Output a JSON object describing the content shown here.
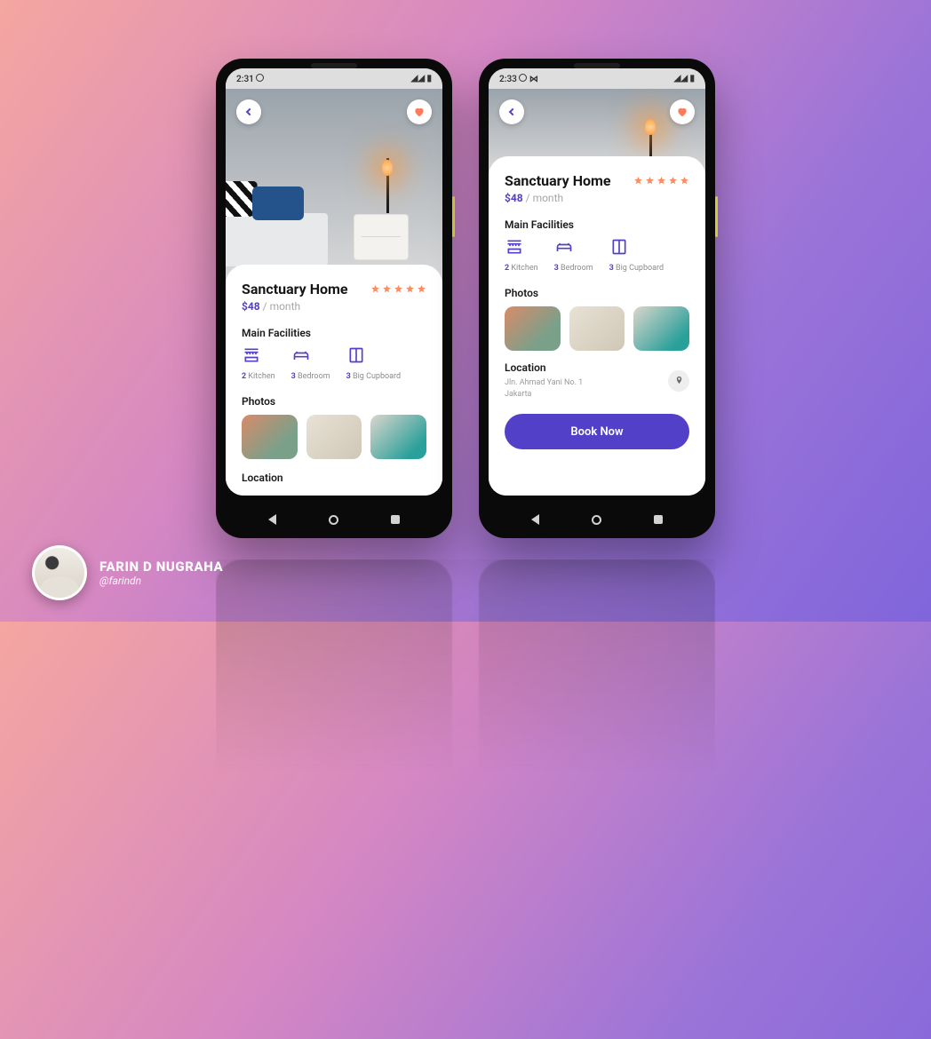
{
  "status": {
    "time_a": "2:31",
    "time_b": "2:33"
  },
  "listing": {
    "title": "Sanctuary Home",
    "price_amount": "$48",
    "price_period": "/ month",
    "rating_stars": 5
  },
  "sections": {
    "facilities_heading": "Main Facilities",
    "photos_heading": "Photos",
    "location_heading": "Location"
  },
  "facilities": [
    {
      "count": "2",
      "label": "Kitchen",
      "icon": "kitchen-icon"
    },
    {
      "count": "3",
      "label": "Bedroom",
      "icon": "bed-icon"
    },
    {
      "count": "3",
      "label": "Big Cupboard",
      "icon": "cupboard-icon"
    }
  ],
  "location": {
    "line1": "Jln. Ahmad Yani No. 1",
    "line2": "Jakarta"
  },
  "cta": {
    "book_label": "Book Now"
  },
  "author": {
    "name": "FARIN D NUGRAHA",
    "handle": "@farindn"
  }
}
